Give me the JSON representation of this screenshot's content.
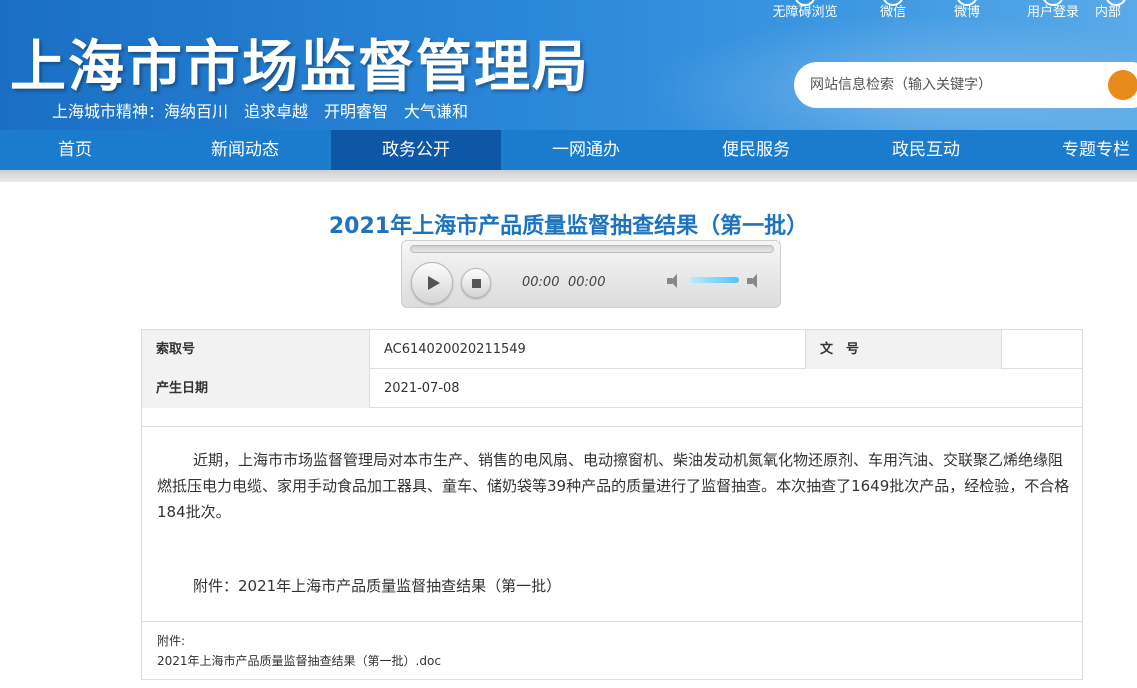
{
  "header": {
    "site_title": "上海市市场监督管理局",
    "slogan": "上海城市精神：海纳百川　追求卓越　开明睿智　大气谦和",
    "toplinks": [
      {
        "label": "无障碍浏览",
        "icon": "accessibility-icon"
      },
      {
        "label": "微信",
        "icon": "wechat-icon"
      },
      {
        "label": "微博",
        "icon": "weibo-icon"
      },
      {
        "label": "用户登录",
        "icon": "user-icon"
      },
      {
        "label": "内部",
        "icon": "internal-icon"
      }
    ],
    "search_placeholder": "网站信息检索（输入关键字）"
  },
  "nav": {
    "items": [
      "首页",
      "新闻动态",
      "政务公开",
      "一网通办",
      "便民服务",
      "政民互动",
      "专题专栏"
    ],
    "active": "政务公开"
  },
  "article": {
    "title": "2021年上海市产品质量监督抽查结果（第一批）",
    "player": {
      "current_time": "00:00",
      "duration": "00:00"
    },
    "info": {
      "index_label": "索取号",
      "index_value": "AC614020020211549",
      "doc_no_label": "文　号",
      "doc_no_value": "",
      "date_label": "产生日期",
      "date_value": "2021-07-08"
    },
    "paragraph": "近期，上海市市场监督管理局对本市生产、销售的电风扇、电动擦窗机、柴油发动机氮氧化物还原剂、车用汽油、交联聚乙烯绝缘阻燃抵压电力电缆、家用手动食品加工器具、童车、储奶袋等39种产品的质量进行了监督抽查。本次抽查了1649批次产品，经检验，不合格184批次。",
    "attachment_line": "附件：2021年上海市产品质量监督抽查结果（第一批）",
    "attachments_heading": "附件:",
    "attachment_file": "2021年上海市产品质量监督抽查结果（第一批）.doc"
  },
  "colors": {
    "header_blue": "#2a86d8",
    "nav_blue": "#1b7ccd",
    "nav_active": "#0e56a6",
    "title_blue": "#1e73be",
    "search_button": "#e98b1a"
  }
}
